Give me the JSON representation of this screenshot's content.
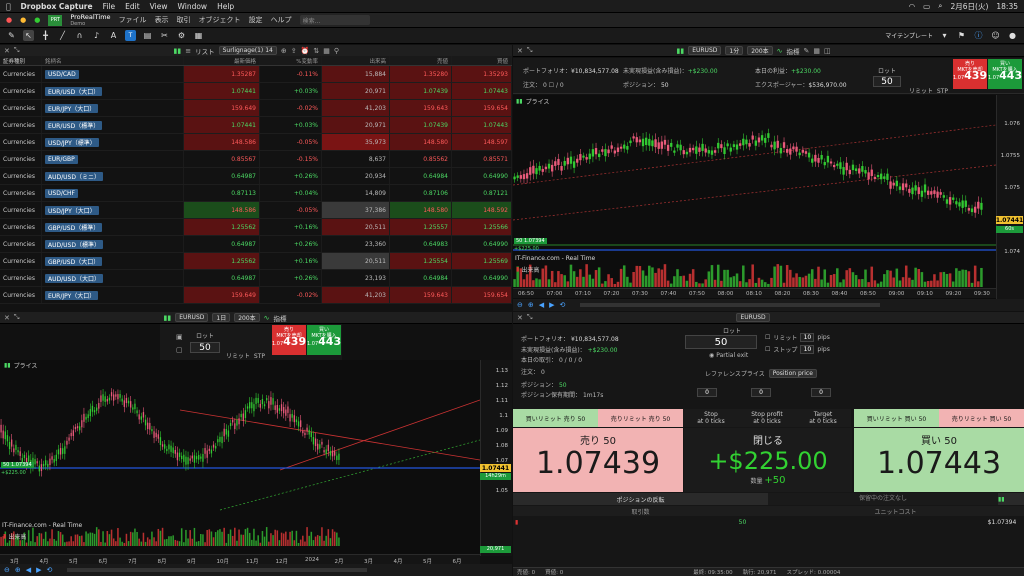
{
  "menubar": {
    "app": "Dropbox Capture",
    "items": [
      "File",
      "Edit",
      "View",
      "Window",
      "Help"
    ],
    "date": "2月6日(火)",
    "time": "18:35"
  },
  "appheader": {
    "brand": "ProRealTime",
    "sub": "Demo",
    "menus": [
      "ファイル",
      "表示",
      "取引",
      "オブジェクト",
      "設定",
      "ヘルプ"
    ],
    "search_placeholder": "検索..."
  },
  "toolbar": {
    "template": "マイテンプレート"
  },
  "watchlist": {
    "list_label": "リスト",
    "list_name": "Surlignage(1)",
    "list_count": "14",
    "headers": [
      "証券種別",
      "銘柄名",
      "最新価格",
      "%変動率",
      "出来高",
      "売値",
      "買値"
    ],
    "rows": [
      {
        "type": "Currencies",
        "sym": "USD/CAD",
        "last": "1.35287",
        "chg": "-0.11%",
        "vol": "15,884",
        "bid": "1.35280",
        "ask": "1.35293",
        "cl": "red",
        "bg": "bgr",
        "vbg": "bgr"
      },
      {
        "type": "Currencies",
        "sym": "EUR/USD（大口）",
        "last": "1.07441",
        "chg": "+0.03%",
        "vol": "20,971",
        "bid": "1.07439",
        "ask": "1.07443",
        "cl": "green",
        "bg": "bgr",
        "vbg": "bgr"
      },
      {
        "type": "Currencies",
        "sym": "EUR/JPY（大口）",
        "last": "159.649",
        "chg": "-0.02%",
        "vol": "41,203",
        "bid": "159.643",
        "ask": "159.654",
        "cl": "red",
        "bg": "bgr",
        "vbg": "bgr"
      },
      {
        "type": "Currencies",
        "sym": "EUR/USD（標準）",
        "last": "1.07441",
        "chg": "+0.03%",
        "vol": "20,971",
        "bid": "1.07439",
        "ask": "1.07443",
        "cl": "green",
        "bg": "bgr",
        "vbg": "bgr"
      },
      {
        "type": "Currencies",
        "sym": "USD/JPY（標準）",
        "last": "148.586",
        "chg": "-0.05%",
        "vol": "35,973",
        "bid": "148.580",
        "ask": "148.597",
        "cl": "red",
        "bg": "bgr",
        "vbg": "bgd"
      },
      {
        "type": "Currencies",
        "sym": "EUR/GBP",
        "last": "0.85567",
        "chg": "-0.15%",
        "vol": "8,637",
        "bid": "0.85562",
        "ask": "0.85571",
        "cl": "red",
        "bg": "",
        "vbg": ""
      },
      {
        "type": "Currencies",
        "sym": "AUD/USD（ミニ）",
        "last": "0.64987",
        "chg": "+0.26%",
        "vol": "20,934",
        "bid": "0.64984",
        "ask": "0.64990",
        "cl": "green",
        "bg": "",
        "vbg": ""
      },
      {
        "type": "Currencies",
        "sym": "USD/CHF",
        "last": "0.87113",
        "chg": "+0.04%",
        "vol": "14,809",
        "bid": "0.87106",
        "ask": "0.87121",
        "cl": "green",
        "bg": "",
        "vbg": ""
      },
      {
        "type": "Currencies",
        "sym": "USD/JPY（大口）",
        "last": "148.586",
        "chg": "-0.05%",
        "vol": "37,386",
        "bid": "148.580",
        "ask": "148.592",
        "cl": "red",
        "bg": "bgg",
        "vbg": "bgk"
      },
      {
        "type": "Currencies",
        "sym": "GBP/USD（標準）",
        "last": "1.25562",
        "chg": "+0.16%",
        "vol": "20,511",
        "bid": "1.25557",
        "ask": "1.25566",
        "cl": "green",
        "bg": "bgr",
        "vbg": "bgr"
      },
      {
        "type": "Currencies",
        "sym": "AUD/USD（標準）",
        "last": "0.64987",
        "chg": "+0.26%",
        "vol": "23,360",
        "bid": "0.64983",
        "ask": "0.64990",
        "cl": "green",
        "bg": "",
        "vbg": ""
      },
      {
        "type": "Currencies",
        "sym": "GBP/USD（大口）",
        "last": "1.25562",
        "chg": "+0.16%",
        "vol": "20,511",
        "bid": "1.25554",
        "ask": "1.25569",
        "cl": "green",
        "bg": "bgr",
        "vbg": "bgk"
      },
      {
        "type": "Currencies",
        "sym": "AUD/USD（大口）",
        "last": "0.64987",
        "chg": "+0.26%",
        "vol": "23,193",
        "bid": "0.64984",
        "ask": "0.64990",
        "cl": "green",
        "bg": "",
        "vbg": ""
      },
      {
        "type": "Currencies",
        "sym": "EUR/JPY（大口）",
        "last": "159.649",
        "chg": "-0.02%",
        "vol": "41,203",
        "bid": "159.643",
        "ask": "159.654",
        "cl": "red",
        "bg": "bgr",
        "vbg": "bgr"
      }
    ]
  },
  "chart1": {
    "symbol": "EURUSD",
    "interval": "1分",
    "bars": "200本",
    "indicator": "指標",
    "portfolio_label": "ポートフォリオ：",
    "portfolio": "¥10,834,577.08",
    "upl_label": "未実現損益(含み損益)：",
    "upl": "+$230.00",
    "today_label": "本日の利益：",
    "today": "+$230.00",
    "order_label": "注文：",
    "order": "0",
    "position_label": "ポジション：",
    "position": "50",
    "exposure_label": "エクスポージャー：",
    "exposure": "$536,970.00",
    "lot_label": "ロット",
    "lot": "50",
    "limit": "リミット",
    "stp": "STP",
    "sell_label": "MKTを売却",
    "buy_label": "MKTを購入",
    "sell_big": "439",
    "buy_big": "443",
    "sell_pre": "1.07",
    "buy_pre": "1.07",
    "sell_hdr": "売り",
    "buy_hdr": "買い",
    "price_label": "プライス",
    "source": "IT-Finance.com - Real Time",
    "volume": "出来高",
    "pos_tag": "50 1.07394",
    "pos_pl": "+$225.00",
    "lastprice": "1.07441",
    "cd": "60s",
    "yticks": [
      "1.076",
      "1.0755",
      "1.075",
      "1.0745",
      "1.074"
    ],
    "xticks": [
      "06:50",
      "07:00",
      "07:10",
      "07:20",
      "07:30",
      "07:40",
      "07:50",
      "08:00",
      "08:10",
      "08:20",
      "08:30",
      "08:40",
      "08:50",
      "09:00",
      "09:10",
      "09:20",
      "09:30"
    ]
  },
  "chart2": {
    "symbol": "EURUSD",
    "interval": "1日",
    "bars": "200本",
    "indicator": "指標",
    "lot_label": "ロット",
    "lot": "50",
    "limit": "リミット",
    "stp": "STP",
    "sell_label": "MKTを売却",
    "buy_label": "MKTを購入",
    "sell_big": "439",
    "buy_big": "443",
    "sell_pre": "1.07",
    "buy_pre": "1.07",
    "sell_hdr": "売り",
    "buy_hdr": "買い",
    "price_label": "プライス",
    "source": "IT-Finance.com - Real Time",
    "volume": "出来高",
    "pos_tag": "50 1.07394",
    "pos_pl": "+$225.00",
    "lastprice": "1.07441",
    "cd": "14h29m",
    "vol_tag": "20,971",
    "yticks": [
      "1.13",
      "1.12",
      "1.11",
      "1.1",
      "1.09",
      "1.08",
      "1.07",
      "1.06",
      "1.05"
    ],
    "xticks": [
      "3月",
      "4月",
      "5月",
      "6月",
      "7月",
      "8月",
      "9月",
      "10月",
      "11月",
      "12月",
      "2024",
      "2月",
      "3月",
      "4月",
      "5月",
      "6月"
    ]
  },
  "ticket": {
    "symbol": "EURUSD",
    "portfolio_label": "ポートフォリオ：",
    "portfolio": "¥10,834,577.08",
    "upl_label": "未実現損益(含み損益)：",
    "upl": "+$230.00",
    "today_label": "本日の取引：",
    "today": "0 / 0 / 0",
    "order_label": "注文：",
    "order": "0",
    "position_label": "ポジション：",
    "position": "50",
    "duration_label": "ポジション保有期間：",
    "duration": "1m17s",
    "lot_label": "ロット",
    "lot": "50",
    "partial": "Partial exit",
    "limit": "リミット",
    "stop": "ストップ",
    "pips": "pips",
    "limit_val": "10",
    "stop_val": "10",
    "ref_label": "レファレンスプライス",
    "ref_val": "Position price",
    "zero": "0",
    "buy_limit": "買いリミット 売り 50",
    "sell_limit": "売りリミット 売り 50",
    "buy_limit_r": "買いリミット 買い 50",
    "sell_limit_r": "売りリミット 買い 50",
    "stop_l": "Stop",
    "stop_s": "at 0 ticks",
    "sp_l": "Stop profit",
    "sp_s": "at 0 ticks",
    "tg_l": "Target",
    "tg_s": "at 0 ticks",
    "sell_title": "売り 50",
    "sell_price": "1.07439",
    "close_title": "閉じる",
    "close_pl": "+$225.00",
    "close_qty_label": "数量",
    "close_qty": "+50",
    "buy_title": "買い 50",
    "buy_price": "1.07443",
    "tab1": "ポジションの反転",
    "tab2": "保留中の注文なし",
    "col1": "取引数",
    "col2": "ユニットコスト",
    "pos_qty": "50",
    "pos_cost": "$1.07394"
  },
  "status": {
    "bid_label": "売値",
    "bid": "0",
    "ask_label": "買値",
    "ask": "0",
    "last_label": "最終",
    "last": "09:35:00",
    "exec_label": "執行",
    "exec": "20,971",
    "spread_label": "スプレッド",
    "spread": "0.00004"
  },
  "colors": {
    "up": "#32c832",
    "down": "#e85a7a",
    "sell": "#d93030",
    "buy": "#1c9a3a"
  }
}
